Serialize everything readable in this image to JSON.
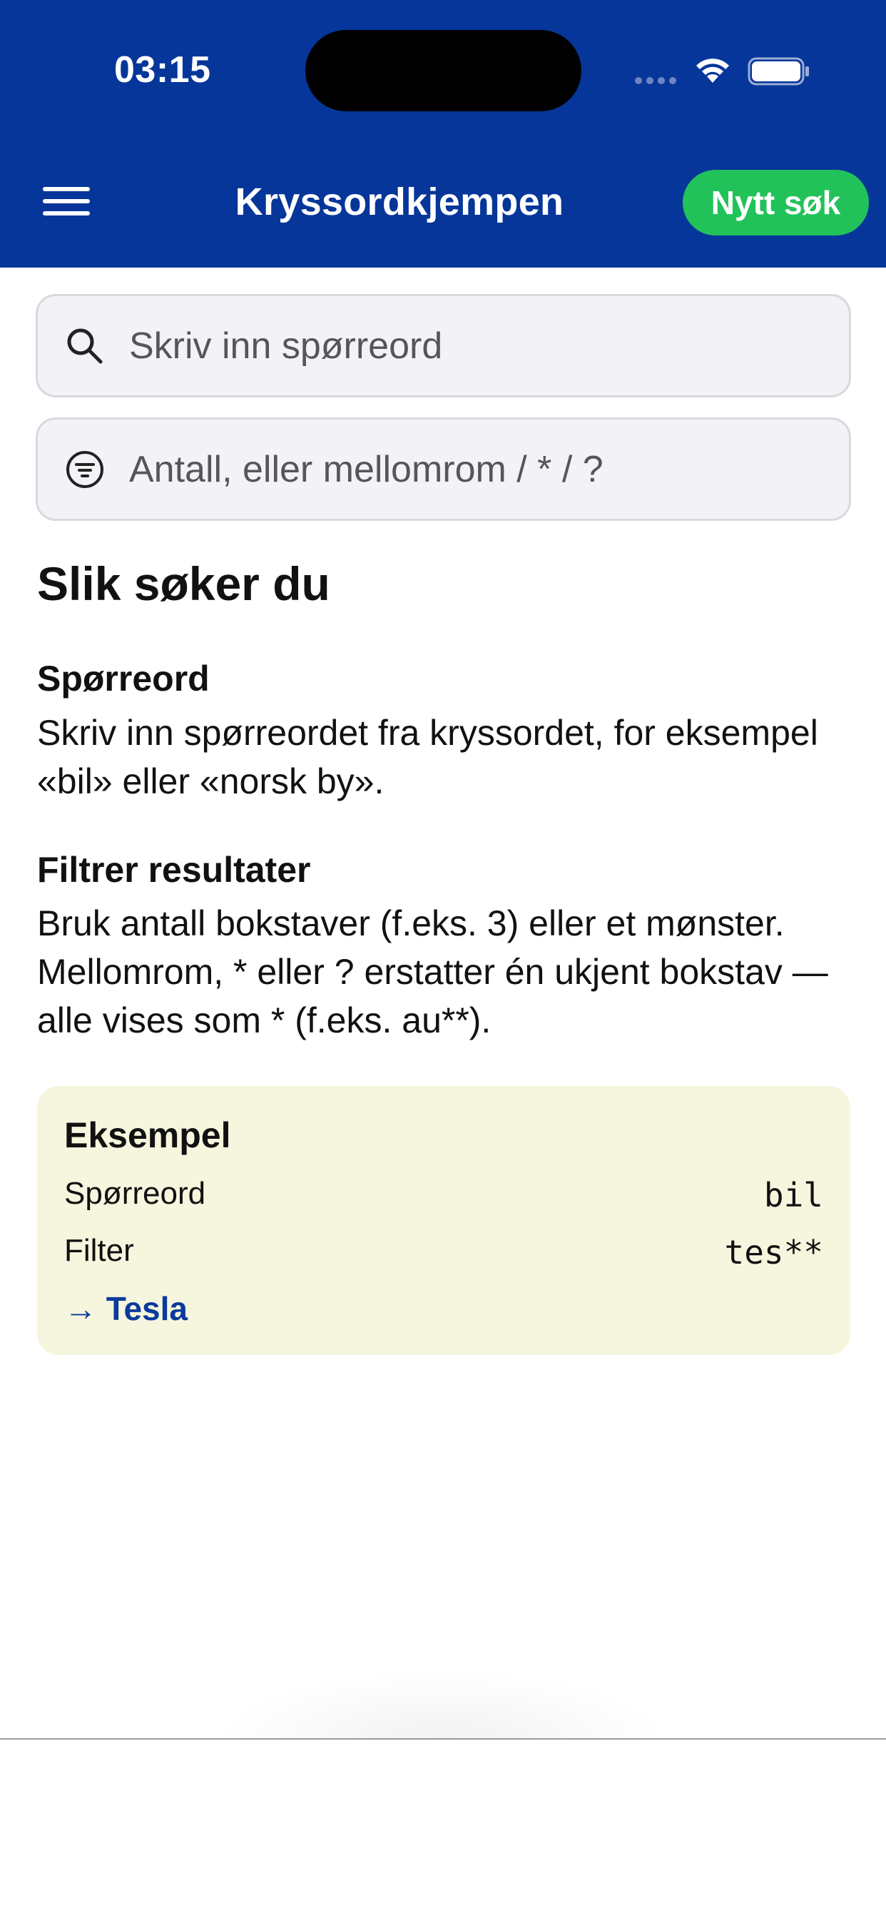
{
  "status_bar": {
    "time": "03:15"
  },
  "header": {
    "title": "Kryssordkjempen",
    "new_search_label": "Nytt søk"
  },
  "search": {
    "query_placeholder": "Skriv inn spørreord",
    "filter_placeholder": "Antall, eller mellomrom / * / ?"
  },
  "help": {
    "heading": "Slik søker du",
    "sections": [
      {
        "title": "Spørreord",
        "body": "Skriv inn spørreordet fra kryssordet, for eksempel «bil» eller «norsk by»."
      },
      {
        "title": "Filtrer resultater",
        "body": "Bruk antall bokstaver (f.eks. 3) eller et mønster. Mellomrom, * eller ? erstatter én ukjent bokstav — alle vises som * (f.eks. au**)."
      }
    ]
  },
  "example": {
    "title": "Eksempel",
    "rows": [
      {
        "label": "Spørreord",
        "value": "bil"
      },
      {
        "label": "Filter",
        "value": "tes**"
      }
    ],
    "result": "→ Tesla"
  },
  "colors": {
    "header_bg": "#063699",
    "accent_green": "#22c25a",
    "example_bg": "#f6f6df",
    "link_blue": "#0a3a9c"
  },
  "icons": [
    "menu-icon",
    "search-icon",
    "filter-icon",
    "wifi-icon",
    "battery-icon",
    "signal-icon"
  ]
}
